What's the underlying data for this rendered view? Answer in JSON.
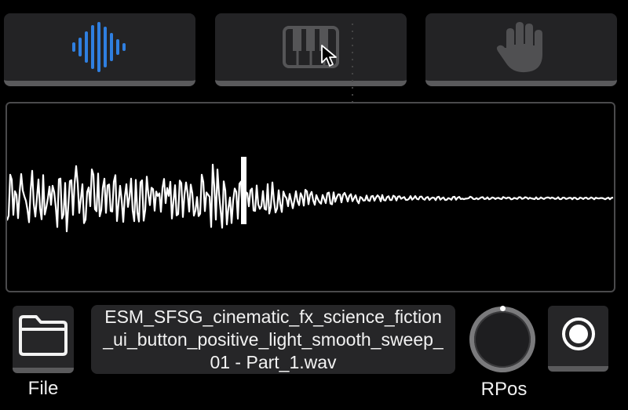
{
  "modes": [
    {
      "name": "waveform-mode",
      "icon": "waveform-icon",
      "active": true
    },
    {
      "name": "keyboard-mode",
      "icon": "piano-keys-icon",
      "active": false
    },
    {
      "name": "hand-mode",
      "icon": "hand-icon",
      "active": false
    }
  ],
  "colors": {
    "accent": "#2f7fe0",
    "inactive_icon": "#555557",
    "button_bg": "#232325",
    "panel_border": "#4a4a4c",
    "waveform": "#ffffff"
  },
  "file": {
    "label": "File",
    "name": "ESM_SFSG_cinematic_fx_science_fiction_ui_button_positive_light_smooth_sweep_01 - Part_1.wav"
  },
  "knob": {
    "label": "RPos"
  }
}
